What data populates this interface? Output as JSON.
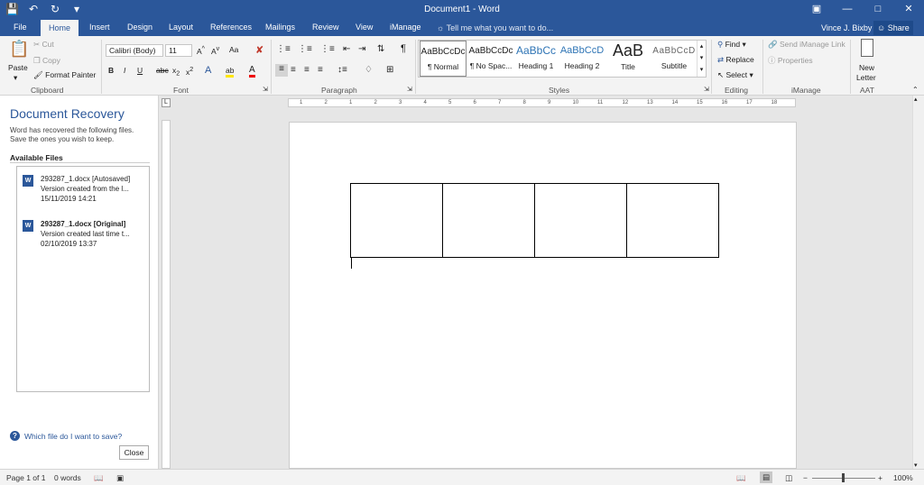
{
  "window": {
    "title": "Document1 - Word"
  },
  "tabs": [
    "File",
    "Home",
    "Insert",
    "Design",
    "Layout",
    "References",
    "Mailings",
    "Review",
    "View",
    "iManage"
  ],
  "tell_me": "Tell me what you want to do...",
  "user": "Vince J. Bixby",
  "share": "Share",
  "ribbon": {
    "clipboard": {
      "paste": "Paste",
      "cut": "Cut",
      "copy": "Copy",
      "format_painter": "Format Painter",
      "label": "Clipboard"
    },
    "font": {
      "name": "Calibri (Body)",
      "size": "11",
      "label": "Font",
      "change_case": "Aa"
    },
    "paragraph": {
      "label": "Paragraph"
    },
    "styles": {
      "label": "Styles",
      "items": [
        {
          "sample": "AaBbCcDc",
          "name": "¶ Normal"
        },
        {
          "sample": "AaBbCcDc",
          "name": "¶ No Spac..."
        },
        {
          "sample": "AaBbCc",
          "name": "Heading 1"
        },
        {
          "sample": "AaBbCcD",
          "name": "Heading 2"
        },
        {
          "sample": "AaB",
          "name": "Title"
        },
        {
          "sample": "AaBbCcD",
          "name": "Subtitle"
        }
      ]
    },
    "editing": {
      "find": "Find",
      "replace": "Replace",
      "select": "Select",
      "label": "Editing"
    },
    "imanage": {
      "send_link": "Send iManage Link",
      "properties": "Properties",
      "label": "iManage"
    },
    "aat": {
      "new_letter_1": "New",
      "new_letter_2": "Letter",
      "label": "AAT"
    }
  },
  "recovery": {
    "title": "Document Recovery",
    "description": "Word has recovered the following files. Save the ones you wish to keep.",
    "available": "Available Files",
    "files": [
      {
        "name": "293287_1.docx  [Autosaved]",
        "desc": "Version created from the l...",
        "date": "15/11/2019 14:21"
      },
      {
        "name": "293287_1.docx  [Original]",
        "desc": "Version created last time t...",
        "date": "02/10/2019 13:37"
      }
    ],
    "help": "Which file do I want to save?",
    "close": "Close"
  },
  "ruler_numbers": [
    "1",
    "2",
    "1",
    "2",
    "3",
    "4",
    "5",
    "6",
    "7",
    "8",
    "9",
    "10",
    "11",
    "12",
    "13",
    "14",
    "15",
    "16",
    "17",
    "18"
  ],
  "status": {
    "page": "Page 1 of 1",
    "words": "0 words",
    "zoom": "100%"
  }
}
